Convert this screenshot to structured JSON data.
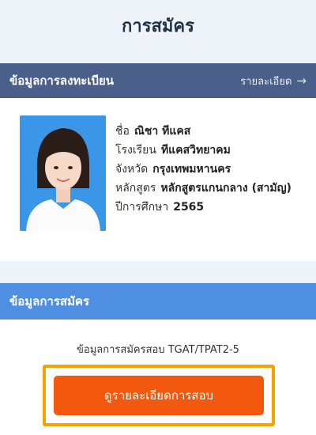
{
  "header": {
    "title": "การสมัคร"
  },
  "registration": {
    "section_title": "ข้อมูลการลงทะเบียน",
    "details_link": "รายละเอียด",
    "fields": [
      {
        "label": "ชื่อ",
        "value": "ณิชา ทีแคส"
      },
      {
        "label": "โรงเรียน",
        "value": "ทีแคสวิทยาคม"
      },
      {
        "label": "จังหวัด",
        "value": "กรุงเทพมหานคร"
      },
      {
        "label": "หลักสูตร",
        "value": "หลักสูตรแกนกลาง (สามัญ)"
      },
      {
        "label": "ปีการศึกษา",
        "value": "2565"
      }
    ]
  },
  "application": {
    "section_title": "ข้อมูลการสมัคร",
    "description": "ข้อมูลการสมัครสอบ TGAT/TPAT2-5",
    "button_label": "ดูรายละเอียดการสอบ"
  },
  "icons": {
    "details_arrow": "arrow-right-icon"
  },
  "colors": {
    "header_bar": "#4a5f8a",
    "section_bar": "#4f8fe2",
    "button": "#f2590f",
    "highlight_frame": "#f5a300",
    "background": "#eef2f9"
  }
}
